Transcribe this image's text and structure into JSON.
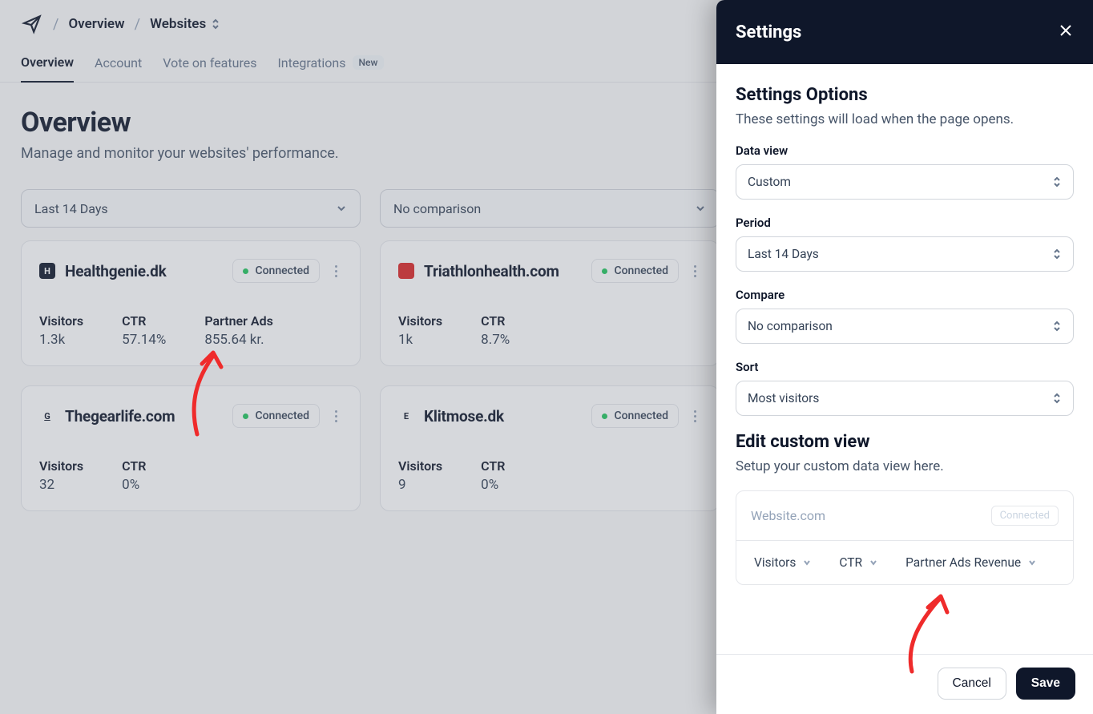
{
  "breadcrumb": {
    "items": [
      "Overview",
      "Websites"
    ]
  },
  "tabs": {
    "items": [
      {
        "label": "Overview",
        "active": true
      },
      {
        "label": "Account"
      },
      {
        "label": "Vote on features"
      },
      {
        "label": "Integrations",
        "badge": "New"
      }
    ]
  },
  "page": {
    "title": "Overview",
    "subtitle": "Manage and monitor your websites' performance."
  },
  "filters": {
    "period": "Last 14 Days",
    "compare": "No comparison"
  },
  "cards": [
    {
      "name": "Healthgenie.dk",
      "icon_bg": "#0f172a",
      "icon_text": "H",
      "status": "Connected",
      "stats": [
        {
          "label": "Visitors",
          "value": "1.3k"
        },
        {
          "label": "CTR",
          "value": "57.14%"
        },
        {
          "label": "Partner Ads",
          "value": "855.64 kr."
        }
      ]
    },
    {
      "name": "Triathlonhealth.com",
      "icon_bg": "#dc2626",
      "icon_text": "",
      "status": "Connected",
      "stats": [
        {
          "label": "Visitors",
          "value": "1k"
        },
        {
          "label": "CTR",
          "value": "8.7%"
        }
      ]
    },
    {
      "name": "Thegearlife.com",
      "icon_bg": "#ffffff",
      "icon_fg": "#0f172a",
      "icon_text": "G",
      "icon_underline": true,
      "status": "Connected",
      "stats": [
        {
          "label": "Visitors",
          "value": "32"
        },
        {
          "label": "CTR",
          "value": "0%"
        }
      ]
    },
    {
      "name": "Klitmose.dk",
      "icon_bg": "#ffffff",
      "icon_fg": "#0f172a",
      "icon_text": "E",
      "status": "Connected",
      "stats": [
        {
          "label": "Visitors",
          "value": "9"
        },
        {
          "label": "CTR",
          "value": "0%"
        }
      ]
    }
  ],
  "drawer": {
    "title": "Settings",
    "section1_title": "Settings Options",
    "section1_sub": "These settings will load when the page opens.",
    "fields": {
      "data_view": {
        "label": "Data view",
        "value": "Custom"
      },
      "period": {
        "label": "Period",
        "value": "Last 14 Days"
      },
      "compare": {
        "label": "Compare",
        "value": "No comparison"
      },
      "sort": {
        "label": "Sort",
        "value": "Most visitors"
      }
    },
    "section2_title": "Edit custom view",
    "section2_sub": "Setup your custom data view here.",
    "example": {
      "site": "Website.com",
      "status": "Connected",
      "cols": [
        "Visitors",
        "CTR",
        "Partner Ads Revenue"
      ]
    },
    "cancel": "Cancel",
    "save": "Save"
  }
}
